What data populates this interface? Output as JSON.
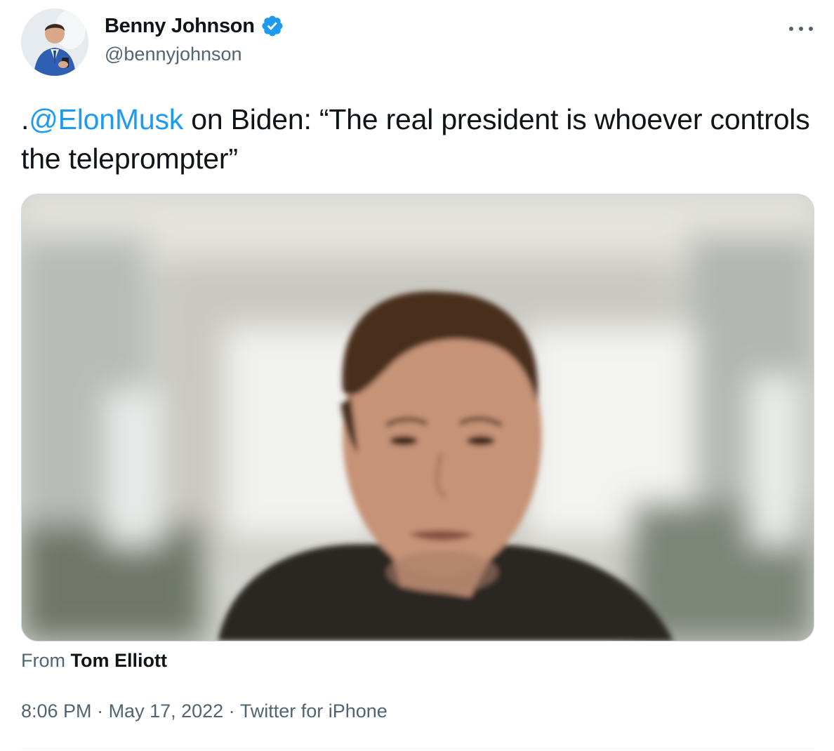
{
  "author": {
    "display_name": "Benny Johnson",
    "handle": "@bennyjohnson",
    "verified": true,
    "avatar_icon": "profile-photo"
  },
  "tweet": {
    "prefix": ".",
    "mention": "@ElonMusk",
    "text": " on Biden: “The real president is whoever controls the teleprompter”"
  },
  "media": {
    "type": "video",
    "attribution_prefix": "From ",
    "attribution_source": "Tom Elliott"
  },
  "meta": {
    "time": "8:06 PM",
    "separator": " · ",
    "date": "May 17, 2022",
    "client": "Twitter for iPhone"
  },
  "colors": {
    "link": "#1d9bf0",
    "text_primary": "#0f1419",
    "text_secondary": "#536471",
    "border": "#cfd9de"
  },
  "icons": {
    "verified": "verified-badge-icon",
    "more": "more-horizontal-icon"
  }
}
